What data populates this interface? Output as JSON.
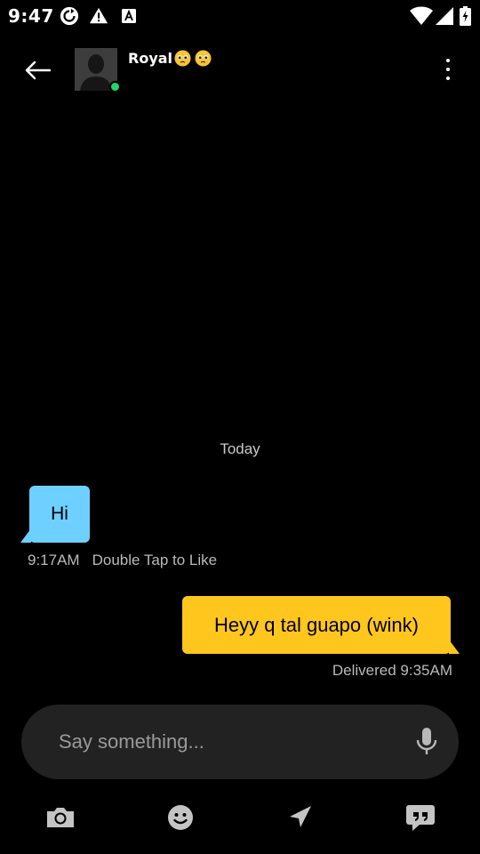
{
  "status_bar": {
    "time": "9:47",
    "icons": [
      "sync-icon",
      "warning-icon",
      "keyboard-a-icon",
      "wifi-icon",
      "signal-icon",
      "battery-icon"
    ]
  },
  "header": {
    "back_icon": "arrow-left-icon",
    "contact_name": "Royal",
    "name_emojis": [
      "pleading-face-emoji",
      "pleading-face-emoji"
    ],
    "online": true,
    "more_icon": "more-vertical-icon"
  },
  "conversation": {
    "date_separator": "Today",
    "messages": [
      {
        "direction": "incoming",
        "text": "Hi",
        "time": "9:17AM",
        "hint": "Double Tap to Like"
      },
      {
        "direction": "outgoing",
        "text": "Heyy q tal guapo (wink)",
        "status": "Delivered 9:35AM"
      }
    ]
  },
  "composer": {
    "placeholder": "Say something...",
    "value": "",
    "mic_icon": "microphone-icon"
  },
  "toolbar": {
    "items": [
      "camera-icon",
      "emoji-icon",
      "send-location-icon",
      "quote-bubble-icon"
    ]
  },
  "colors": {
    "background": "#000000",
    "incoming_bubble": "#6ed0ff",
    "outgoing_bubble": "#ffc61e",
    "composer_bg": "#222222",
    "online": "#22d66a",
    "meta_text": "#b9b9b9"
  }
}
